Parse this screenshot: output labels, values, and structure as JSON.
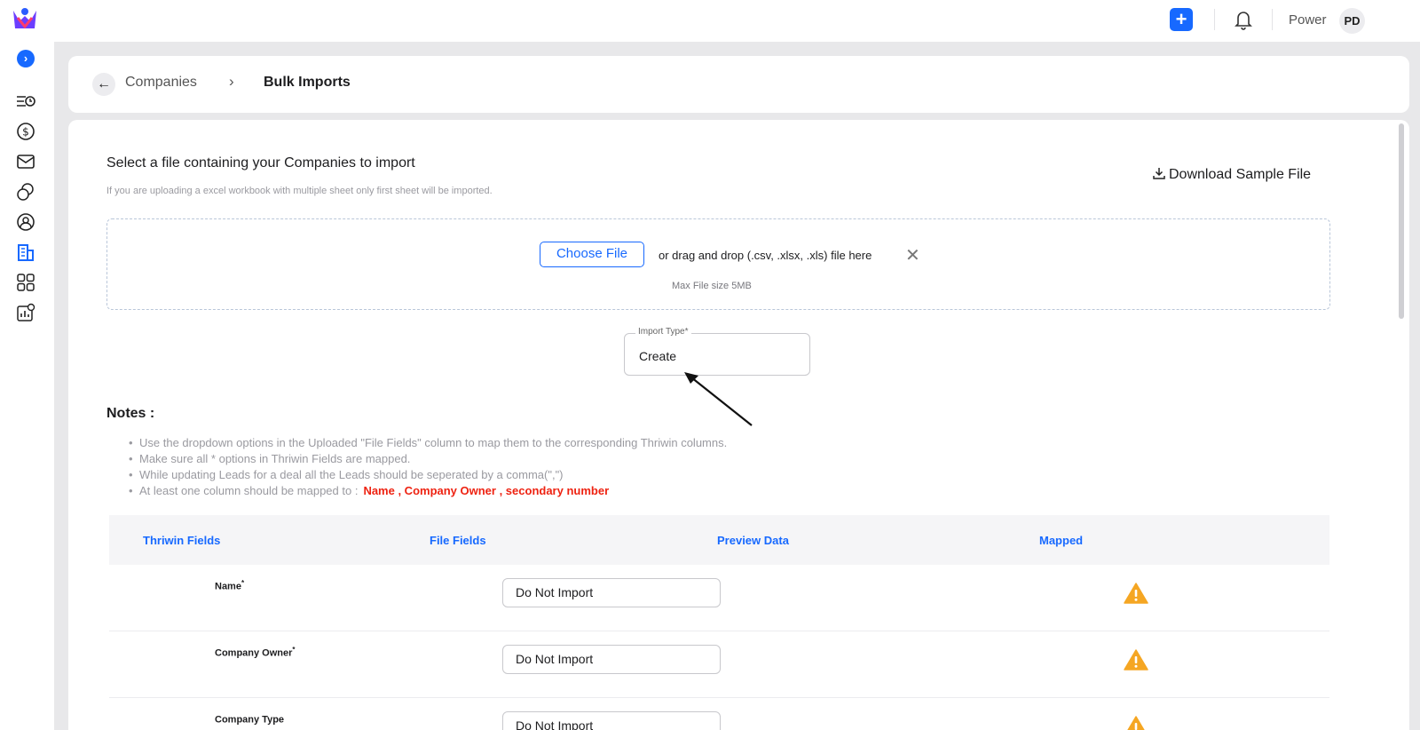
{
  "topbar": {
    "username": "Power",
    "avatar_initials": "PD",
    "add_label": "+"
  },
  "sidebar": {
    "expand_label": "›",
    "items": [
      {
        "name": "activity-timeline-icon"
      },
      {
        "name": "deals-dollar-icon"
      },
      {
        "name": "mail-icon"
      },
      {
        "name": "chat-icon"
      },
      {
        "name": "contacts-icon"
      },
      {
        "name": "companies-icon",
        "active": true
      },
      {
        "name": "apps-grid-icon"
      },
      {
        "name": "reports-settings-icon"
      }
    ]
  },
  "breadcrumb": {
    "back_label": "←",
    "parent": "Companies",
    "separator": "›",
    "current": "Bulk Imports"
  },
  "upload": {
    "title": "Select a file containing your Companies to import",
    "subtitle": "If you are uploading a excel workbook with multiple sheet only first sheet will be imported.",
    "download_label": "Download Sample File",
    "choose_file_label": "Choose File",
    "drop_text": "or drag and drop (.csv, .xlsx, .xls) file here",
    "clear_label": "✕",
    "max_size": "Max File size 5MB"
  },
  "import_type": {
    "label": "Import Type*",
    "value": "Create"
  },
  "notes": {
    "title": "Notes :",
    "items": [
      "Use the dropdown options in the Uploaded \"File Fields\" column to map them to the corresponding Thriwin columns.",
      "Make sure all * options in Thriwin Fields are mapped.",
      "While updating Leads for a deal all the Leads should be seperated by a comma(\",\")",
      "At least one column should be mapped to :"
    ],
    "required_fields": "Name , Company Owner , secondary number"
  },
  "table": {
    "headers": [
      "Thriwin Fields",
      "File Fields",
      "Preview Data",
      "Mapped"
    ],
    "rows": [
      {
        "field": "Name",
        "required": "*",
        "file_field": "Do Not Import",
        "mapped_status": "warning"
      },
      {
        "field": "Company Owner",
        "required": "*",
        "file_field": "Do Not Import",
        "mapped_status": "warning"
      },
      {
        "field": "Company Type",
        "required": "",
        "file_field": "Do Not Import",
        "mapped_status": "warning"
      }
    ]
  },
  "colors": {
    "accent": "#1769ff",
    "required_red": "#ee2211",
    "warning": "#f5a623"
  }
}
